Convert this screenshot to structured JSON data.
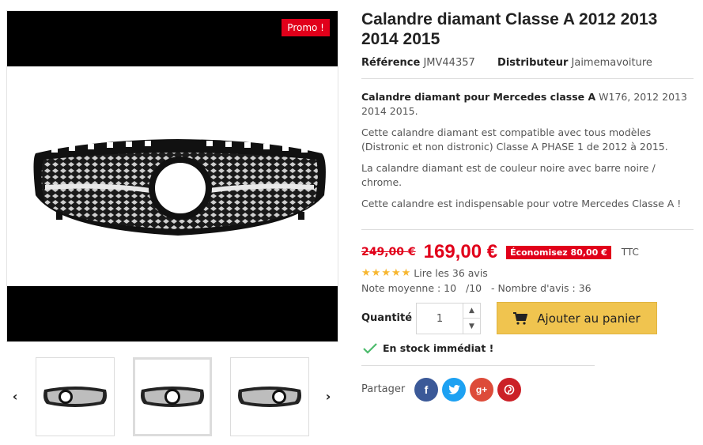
{
  "gallery": {
    "promo_badge": "Promo !",
    "prev_arrow": "‹",
    "next_arrow": "›",
    "thumbnails": 3
  },
  "product": {
    "title": "Calandre diamant Classe A 2012 2013 2014 2015",
    "reference_label": "Référence",
    "reference_value": "JMV44357",
    "distributor_label": "Distributeur",
    "distributor_value": "Jaimemavoiture",
    "description": {
      "p1_bold": "Calandre diamant pour Mercedes classe A",
      "p1_rest": " W176, 2012 2013 2014 2015.",
      "p2": "Cette calandre diamant est compatible avec tous modèles (Distronic et non distronic) Classe A PHASE 1 de 2012 à 2015.",
      "p3": "La calandre diamant est de couleur noire avec barre noire / chrome.",
      "p4": "Cette calandre est indispensable pour votre Mercedes Classe A !"
    }
  },
  "pricing": {
    "old_price": "249,00 €",
    "new_price": "169,00 €",
    "savings_badge": "Économisez 80,00 €",
    "tax_label": "TTC"
  },
  "reviews": {
    "stars": 5,
    "read_link": "Lire les 36 avis",
    "average_text": "Note moyenne : 10   /10   - Nombre d'avis : 36"
  },
  "purchase": {
    "quantity_label": "Quantité",
    "quantity_value": "1",
    "add_to_cart": "Ajouter au panier",
    "stock_text": "En stock immédiat !"
  },
  "share": {
    "label": "Partager",
    "networks": [
      "facebook-icon",
      "twitter-icon",
      "google-plus-icon",
      "pinterest-icon"
    ]
  },
  "colors": {
    "price_red": "#e1001a",
    "cart_yellow": "#f0c44f",
    "facebook": "#3b5998",
    "twitter": "#1da1f2",
    "google_plus": "#dd4b39",
    "pinterest": "#cb2027",
    "stock_green": "#4cbb6c",
    "star": "#f7b731"
  }
}
